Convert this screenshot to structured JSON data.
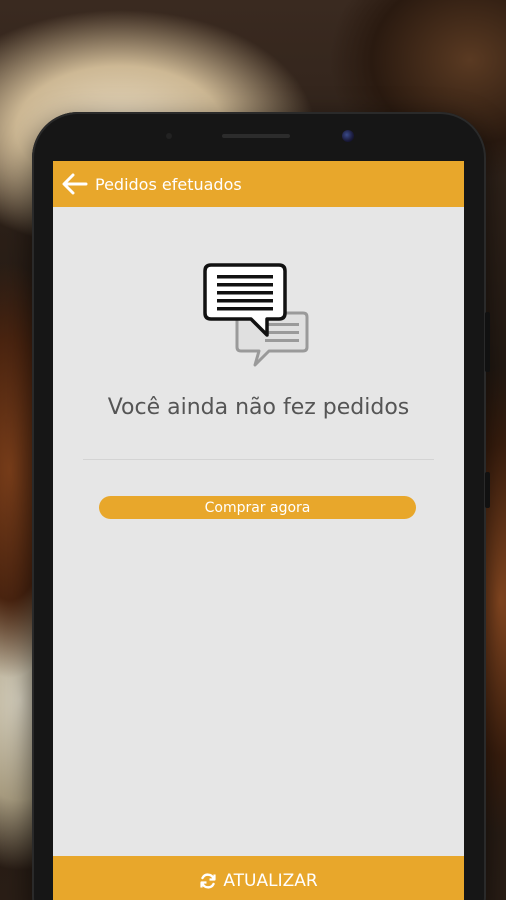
{
  "appbar": {
    "title": "Pedidos efetuados",
    "back_icon": "arrow-left-icon"
  },
  "empty_state": {
    "icon": "chat-bubbles-icon",
    "message": "Você ainda não fez pedidos"
  },
  "actions": {
    "buy_now_label": "Comprar agora",
    "refresh_label": "ATUALIZAR",
    "refresh_icon": "refresh-icon"
  },
  "colors": {
    "accent": "#e8a72b",
    "screen_background": "#e6e6e6",
    "text_muted": "#555555"
  }
}
